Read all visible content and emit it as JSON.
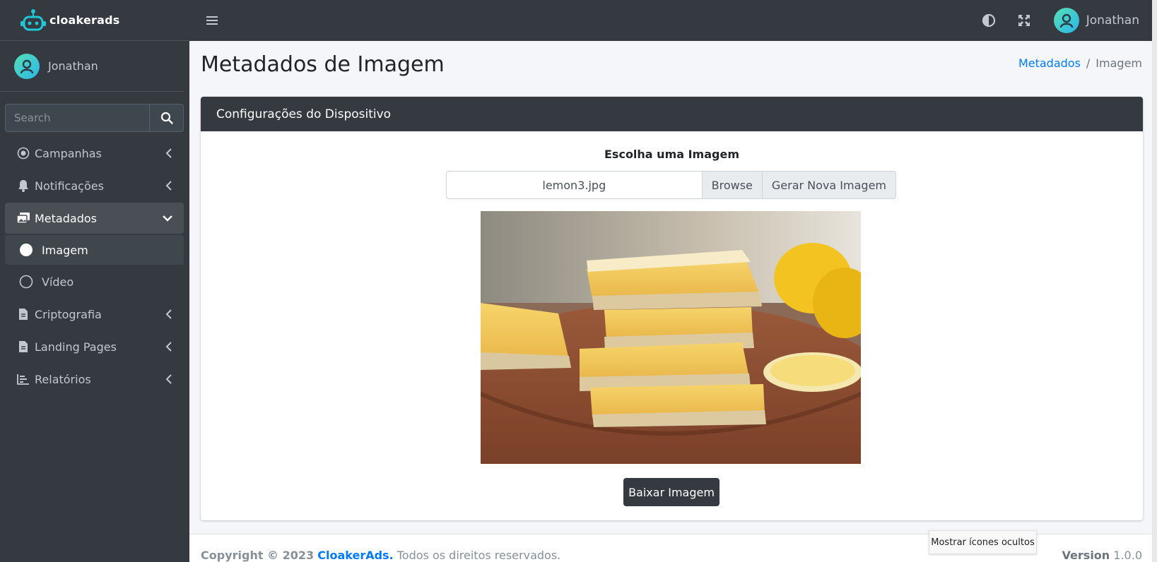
{
  "brand": {
    "name": "cloakerads"
  },
  "sidebar": {
    "user_name": "Jonathan",
    "search_placeholder": "Search",
    "items": [
      {
        "label": "Campanhas",
        "icon": "circle-dot-icon"
      },
      {
        "label": "Notificações",
        "icon": "bell-icon"
      },
      {
        "label": "Metadados",
        "icon": "images-icon",
        "expanded": true
      },
      {
        "label": "Imagem",
        "icon": "circle-filled-icon",
        "active": true
      },
      {
        "label": "Vídeo",
        "icon": "circle-outline-icon"
      },
      {
        "label": "Criptografia",
        "icon": "file-icon"
      },
      {
        "label": "Landing Pages",
        "icon": "file-icon"
      },
      {
        "label": "Relatórios",
        "icon": "chart-icon"
      }
    ]
  },
  "topbar": {
    "user_name": "Jonathan"
  },
  "page": {
    "title": "Metadados de Imagem",
    "breadcrumb": {
      "parent": "Metadados",
      "separator": "/",
      "current": "Imagem"
    }
  },
  "card": {
    "header": "Configurações do Dispositivo",
    "form_label": "Escolha uma Imagem",
    "file_name": "lemon3.jpg",
    "browse_label": "Browse",
    "generate_label": "Gerar Nova Imagem",
    "download_label": "Baixar Imagem"
  },
  "footer": {
    "copyright_prefix": "Copyright © 2023",
    "brand": "CloakerAds.",
    "rights": "Todos os direitos reservados.",
    "version_label": "Version",
    "version": "1.0.0"
  },
  "tooltip": "Mostrar ícones ocultos",
  "colors": {
    "sidebar": "#343a40",
    "accent": "#007bff",
    "content_bg": "#f4f6f9"
  }
}
